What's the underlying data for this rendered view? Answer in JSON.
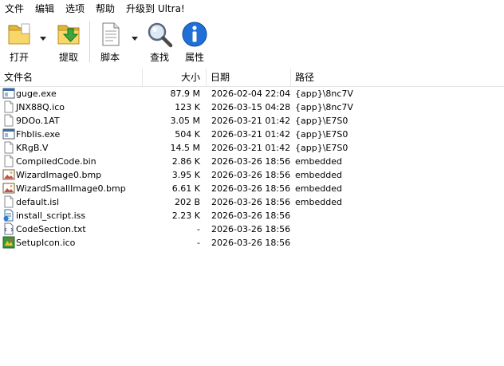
{
  "menu": [
    "文件",
    "编辑",
    "选项",
    "帮助",
    "升级到 Ultra!"
  ],
  "toolbar": {
    "open": "打开",
    "extract": "提取",
    "script": "脚本",
    "find": "查找",
    "properties": "属性"
  },
  "columns": {
    "name": "文件名",
    "size": "大小",
    "date": "日期",
    "path": "路径"
  },
  "files": [
    {
      "name": "guge.exe",
      "size": "87.9 M",
      "date": "2026-02-04 22:04",
      "path": "{app}\\8nc7V",
      "icon": "exe-window-icon"
    },
    {
      "name": "JNX88Q.ico",
      "size": "123 K",
      "date": "2026-03-15 04:28",
      "path": "{app}\\8nc7V",
      "icon": "blank-file-icon"
    },
    {
      "name": "9DOo.1AT",
      "size": "3.05 M",
      "date": "2026-03-21 01:42",
      "path": "{app}\\E7S0",
      "icon": "blank-file-icon"
    },
    {
      "name": "FhbIis.exe",
      "size": "504 K",
      "date": "2026-03-21 01:42",
      "path": "{app}\\E7S0",
      "icon": "exe-window-icon"
    },
    {
      "name": "KRgB.V",
      "size": "14.5 M",
      "date": "2026-03-21 01:42",
      "path": "{app}\\E7S0",
      "icon": "blank-file-icon"
    },
    {
      "name": "CompiledCode.bin",
      "size": "2.86 K",
      "date": "2026-03-26 18:56",
      "path": "embedded",
      "icon": "blank-file-icon"
    },
    {
      "name": "WizardImage0.bmp",
      "size": "3.95 K",
      "date": "2026-03-26 18:56",
      "path": "embedded",
      "icon": "bitmap-image-icon"
    },
    {
      "name": "WizardSmallImage0.bmp",
      "size": "6.61 K",
      "date": "2026-03-26 18:56",
      "path": "embedded",
      "icon": "bitmap-image-icon"
    },
    {
      "name": "default.isl",
      "size": "202 B",
      "date": "2026-03-26 18:56",
      "path": "embedded",
      "icon": "blank-file-icon"
    },
    {
      "name": "install_script.iss",
      "size": "2.23 K",
      "date": "2026-03-26 18:56",
      "path": "",
      "icon": "script-file-icon"
    },
    {
      "name": "CodeSection.txt",
      "size": "-",
      "date": "2026-03-26 18:56",
      "path": "",
      "icon": "code-text-icon"
    },
    {
      "name": "SetupIcon.ico",
      "size": "-",
      "date": "2026-03-26 18:56",
      "path": "",
      "icon": "setup-icon-image"
    }
  ]
}
